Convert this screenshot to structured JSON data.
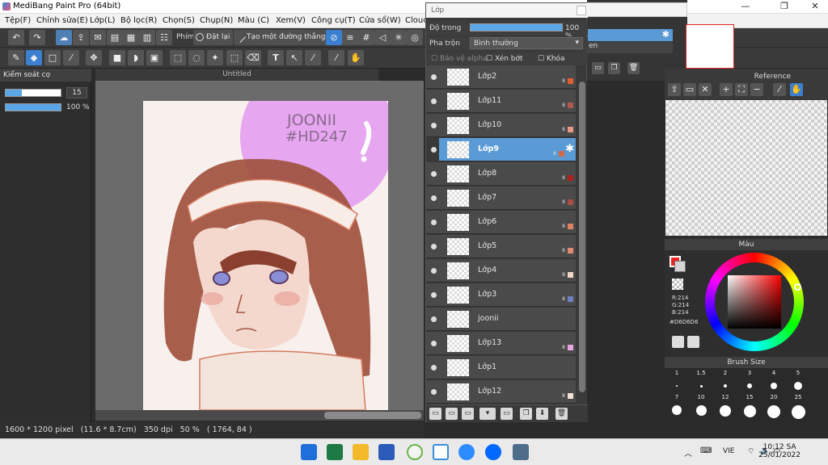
{
  "window": {
    "title": "MediBang Paint Pro (64bit)"
  },
  "menu": [
    "Tệp(F)",
    "Chỉnh sửa(E)",
    "Lớp(L)",
    "Bộ lọc(R)",
    "Chọn(S)",
    "Chụp(N)",
    "Màu (C)",
    "Xem(V)",
    "Công cụ(T)",
    "Cửa sổ(W)",
    "Clouc"
  ],
  "toolbar": {
    "phim_label": "Phím",
    "reset_label": "Đặt lại",
    "straight_line_label": "Tạo một đường thẳng"
  },
  "brush_control": {
    "title": "Kiểm soát cọ",
    "size": "15",
    "opacity": "100 %",
    "size_fraction": 0.3,
    "opacity_fraction": 1.0
  },
  "canvas": {
    "tab_title": "Untitled",
    "art_text_line1": "JOONII",
    "art_text_line2": "#HD247"
  },
  "status": {
    "dimensions": "1600 * 1200 pixel",
    "physical": "(11.6 * 8.7cm)",
    "dpi": "350 dpi",
    "zoom": "50 %",
    "cursor": "( 1764, 84 )"
  },
  "layer_panel": {
    "title": "Lớp",
    "opacity_label": "Độ trong",
    "opacity_value": "100 %",
    "opacity_fraction": 1.0,
    "blend_label": "Pha trộn",
    "blend_value": "Bình thường",
    "protect_alpha": "Bảo vệ alpha",
    "clipping": "Xén bớt",
    "lock": "Khóa",
    "layers": [
      {
        "name": "Lớp2",
        "opacity": "8",
        "color": "#e35d2e",
        "selected": false
      },
      {
        "name": "Lớp11",
        "opacity": "8",
        "color": "#b0584a",
        "selected": false
      },
      {
        "name": "Lớp10",
        "opacity": "8",
        "color": "#e89a82",
        "selected": false
      },
      {
        "name": "Lớp9",
        "opacity": "8",
        "color": "#d06a4a",
        "selected": true
      },
      {
        "name": "Lớp8",
        "opacity": "8",
        "color": "#b0201c",
        "selected": false
      },
      {
        "name": "Lớp7",
        "opacity": "8",
        "color": "#a84c44",
        "selected": false
      },
      {
        "name": "Lớp6",
        "opacity": "8",
        "color": "#de8262",
        "selected": false
      },
      {
        "name": "Lớp5",
        "opacity": "8",
        "color": "#e08a74",
        "selected": false
      },
      {
        "name": "Lớp4",
        "opacity": "8",
        "color": "#f3d6c8",
        "selected": false
      },
      {
        "name": "Lớp3",
        "opacity": "8",
        "color": "#6e7fc2",
        "selected": false
      },
      {
        "name": "joonii",
        "opacity": "",
        "color": "",
        "selected": false
      },
      {
        "name": "Lớp13",
        "opacity": "8",
        "color": "#e6a6e0",
        "selected": false
      },
      {
        "name": "Lớp1",
        "opacity": "",
        "color": "",
        "selected": false
      },
      {
        "name": "Lớp12",
        "opacity": "8",
        "color": "#f3e0d6",
        "selected": false
      }
    ]
  },
  "mid_panel": {
    "item": "en"
  },
  "right_panels": {
    "reference_title": "Reference",
    "color_title": "Màu",
    "rgb_r": "R:214",
    "rgb_g": "G:214",
    "rgb_b": "B:214",
    "hex": "#D6D6D6",
    "brush_size_title": "Brush Size",
    "brush_sizes_row1": [
      "1",
      "1.5",
      "2",
      "3",
      "4",
      "5"
    ],
    "brush_sizes_row2": [
      "7",
      "10",
      "12",
      "15",
      "20",
      "25"
    ]
  },
  "taskbar": {
    "lang": "VIE",
    "time": "10:12 SA",
    "date": "25/01/2022"
  },
  "colors": {
    "accent": "#5b9bd5",
    "highlight": "#3b7fd0",
    "bubble": "#e6a6f0",
    "hair": "#a0523e"
  }
}
